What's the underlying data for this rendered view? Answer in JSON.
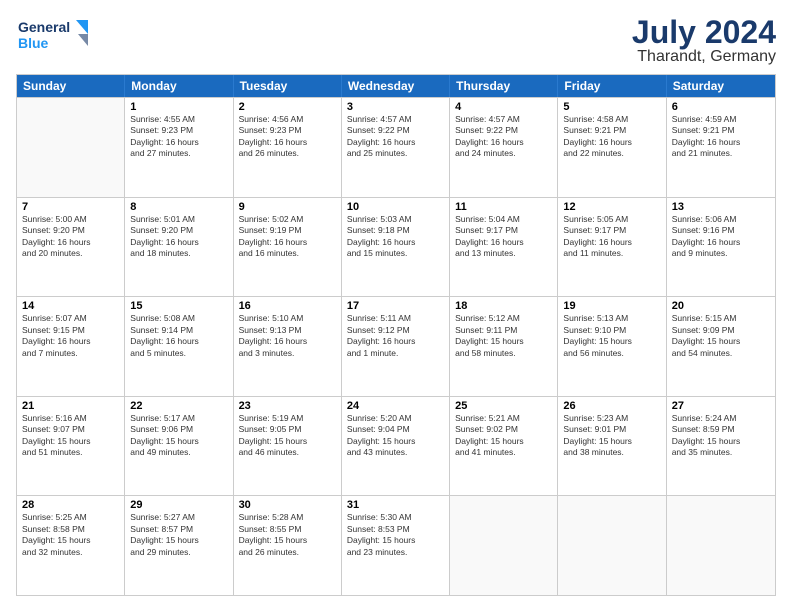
{
  "logo": {
    "line1": "General",
    "line2": "Blue"
  },
  "title": "July 2024",
  "location": "Tharandt, Germany",
  "weekdays": [
    "Sunday",
    "Monday",
    "Tuesday",
    "Wednesday",
    "Thursday",
    "Friday",
    "Saturday"
  ],
  "weeks": [
    [
      {
        "day": "",
        "content": ""
      },
      {
        "day": "1",
        "content": "Sunrise: 4:55 AM\nSunset: 9:23 PM\nDaylight: 16 hours\nand 27 minutes."
      },
      {
        "day": "2",
        "content": "Sunrise: 4:56 AM\nSunset: 9:23 PM\nDaylight: 16 hours\nand 26 minutes."
      },
      {
        "day": "3",
        "content": "Sunrise: 4:57 AM\nSunset: 9:22 PM\nDaylight: 16 hours\nand 25 minutes."
      },
      {
        "day": "4",
        "content": "Sunrise: 4:57 AM\nSunset: 9:22 PM\nDaylight: 16 hours\nand 24 minutes."
      },
      {
        "day": "5",
        "content": "Sunrise: 4:58 AM\nSunset: 9:21 PM\nDaylight: 16 hours\nand 22 minutes."
      },
      {
        "day": "6",
        "content": "Sunrise: 4:59 AM\nSunset: 9:21 PM\nDaylight: 16 hours\nand 21 minutes."
      }
    ],
    [
      {
        "day": "7",
        "content": "Sunrise: 5:00 AM\nSunset: 9:20 PM\nDaylight: 16 hours\nand 20 minutes."
      },
      {
        "day": "8",
        "content": "Sunrise: 5:01 AM\nSunset: 9:20 PM\nDaylight: 16 hours\nand 18 minutes."
      },
      {
        "day": "9",
        "content": "Sunrise: 5:02 AM\nSunset: 9:19 PM\nDaylight: 16 hours\nand 16 minutes."
      },
      {
        "day": "10",
        "content": "Sunrise: 5:03 AM\nSunset: 9:18 PM\nDaylight: 16 hours\nand 15 minutes."
      },
      {
        "day": "11",
        "content": "Sunrise: 5:04 AM\nSunset: 9:17 PM\nDaylight: 16 hours\nand 13 minutes."
      },
      {
        "day": "12",
        "content": "Sunrise: 5:05 AM\nSunset: 9:17 PM\nDaylight: 16 hours\nand 11 minutes."
      },
      {
        "day": "13",
        "content": "Sunrise: 5:06 AM\nSunset: 9:16 PM\nDaylight: 16 hours\nand 9 minutes."
      }
    ],
    [
      {
        "day": "14",
        "content": "Sunrise: 5:07 AM\nSunset: 9:15 PM\nDaylight: 16 hours\nand 7 minutes."
      },
      {
        "day": "15",
        "content": "Sunrise: 5:08 AM\nSunset: 9:14 PM\nDaylight: 16 hours\nand 5 minutes."
      },
      {
        "day": "16",
        "content": "Sunrise: 5:10 AM\nSunset: 9:13 PM\nDaylight: 16 hours\nand 3 minutes."
      },
      {
        "day": "17",
        "content": "Sunrise: 5:11 AM\nSunset: 9:12 PM\nDaylight: 16 hours\nand 1 minute."
      },
      {
        "day": "18",
        "content": "Sunrise: 5:12 AM\nSunset: 9:11 PM\nDaylight: 15 hours\nand 58 minutes."
      },
      {
        "day": "19",
        "content": "Sunrise: 5:13 AM\nSunset: 9:10 PM\nDaylight: 15 hours\nand 56 minutes."
      },
      {
        "day": "20",
        "content": "Sunrise: 5:15 AM\nSunset: 9:09 PM\nDaylight: 15 hours\nand 54 minutes."
      }
    ],
    [
      {
        "day": "21",
        "content": "Sunrise: 5:16 AM\nSunset: 9:07 PM\nDaylight: 15 hours\nand 51 minutes."
      },
      {
        "day": "22",
        "content": "Sunrise: 5:17 AM\nSunset: 9:06 PM\nDaylight: 15 hours\nand 49 minutes."
      },
      {
        "day": "23",
        "content": "Sunrise: 5:19 AM\nSunset: 9:05 PM\nDaylight: 15 hours\nand 46 minutes."
      },
      {
        "day": "24",
        "content": "Sunrise: 5:20 AM\nSunset: 9:04 PM\nDaylight: 15 hours\nand 43 minutes."
      },
      {
        "day": "25",
        "content": "Sunrise: 5:21 AM\nSunset: 9:02 PM\nDaylight: 15 hours\nand 41 minutes."
      },
      {
        "day": "26",
        "content": "Sunrise: 5:23 AM\nSunset: 9:01 PM\nDaylight: 15 hours\nand 38 minutes."
      },
      {
        "day": "27",
        "content": "Sunrise: 5:24 AM\nSunset: 8:59 PM\nDaylight: 15 hours\nand 35 minutes."
      }
    ],
    [
      {
        "day": "28",
        "content": "Sunrise: 5:25 AM\nSunset: 8:58 PM\nDaylight: 15 hours\nand 32 minutes."
      },
      {
        "day": "29",
        "content": "Sunrise: 5:27 AM\nSunset: 8:57 PM\nDaylight: 15 hours\nand 29 minutes."
      },
      {
        "day": "30",
        "content": "Sunrise: 5:28 AM\nSunset: 8:55 PM\nDaylight: 15 hours\nand 26 minutes."
      },
      {
        "day": "31",
        "content": "Sunrise: 5:30 AM\nSunset: 8:53 PM\nDaylight: 15 hours\nand 23 minutes."
      },
      {
        "day": "",
        "content": ""
      },
      {
        "day": "",
        "content": ""
      },
      {
        "day": "",
        "content": ""
      }
    ]
  ]
}
